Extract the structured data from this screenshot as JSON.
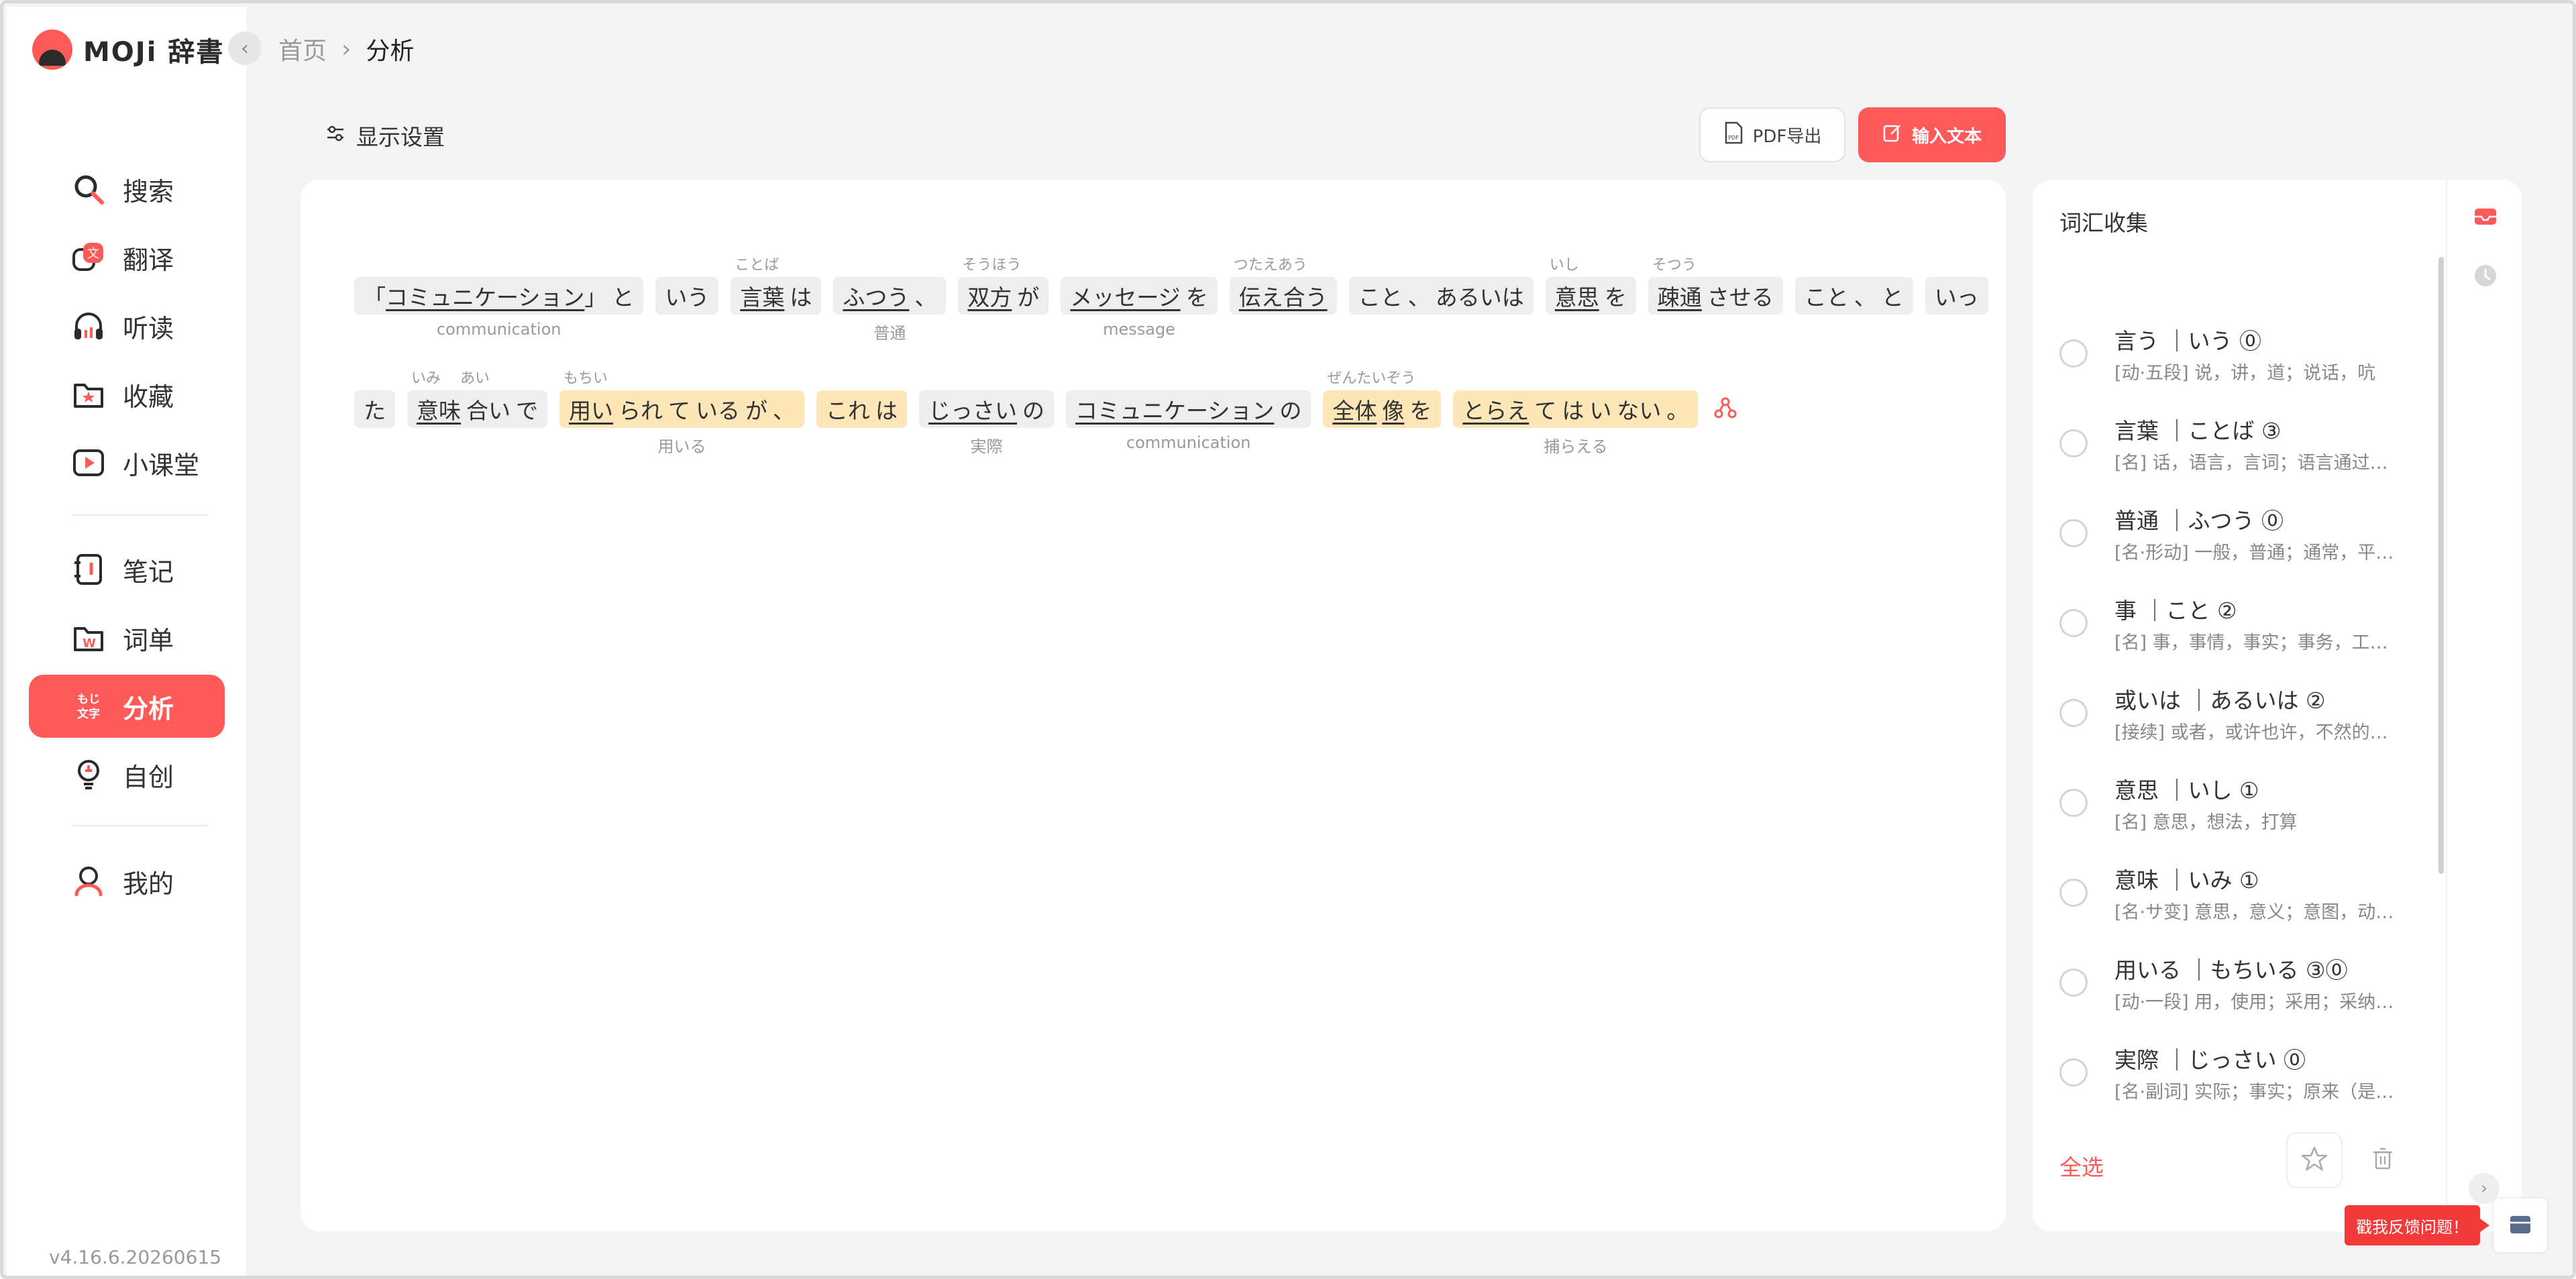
{
  "app": {
    "logo_text": "MOJi 辞書",
    "version": "v4.16.6.20260615"
  },
  "breadcrumb": {
    "home": "首页",
    "current": "分析"
  },
  "sidebar": {
    "items": [
      {
        "label": "搜索",
        "icon": "search-icon"
      },
      {
        "label": "翻译",
        "icon": "translate-icon"
      },
      {
        "label": "听读",
        "icon": "headphones-icon"
      },
      {
        "label": "收藏",
        "icon": "folder-star-icon"
      },
      {
        "label": "小课堂",
        "icon": "play-icon"
      },
      {
        "label": "笔记",
        "icon": "notebook-icon"
      },
      {
        "label": "词单",
        "icon": "wordlist-icon"
      },
      {
        "label": "分析",
        "icon": "moji-text-icon",
        "icon_text": "もじ文字"
      },
      {
        "label": "自创",
        "icon": "lightbulb-icon"
      },
      {
        "label": "我的",
        "icon": "user-icon"
      }
    ],
    "active": "分析"
  },
  "toolbar": {
    "display_settings": "显示设置",
    "pdf_export": "PDF导出",
    "input_text": "输入文本"
  },
  "analysis": {
    "line1": [
      {
        "parts": [
          {
            "t": "「"
          },
          {
            "t": "コミュニケーション",
            "u": true
          },
          {
            "t": "」"
          },
          {
            "t": "と",
            "sp": true
          }
        ],
        "gloss": "communication"
      },
      {
        "parts": [
          {
            "t": "いう"
          }
        ]
      },
      {
        "parts": [
          {
            "t": "言葉",
            "u": true
          },
          {
            "t": "は",
            "sp": true
          }
        ],
        "ruby": "ことば"
      },
      {
        "parts": [
          {
            "t": "ふつう",
            "u": true
          },
          {
            "t": "、",
            "sp": true
          }
        ],
        "gloss": "普通"
      },
      {
        "parts": [
          {
            "t": "双方",
            "u": true
          },
          {
            "t": "が",
            "sp": true
          }
        ],
        "ruby": "そうほう"
      },
      {
        "parts": [
          {
            "t": "メッセージ",
            "u": true
          },
          {
            "t": "を",
            "sp": true
          }
        ],
        "gloss": "message"
      },
      {
        "parts": [
          {
            "t": "伝え合う",
            "u": true
          }
        ],
        "ruby": "つたえあう"
      },
      {
        "parts": [
          {
            "t": "こと"
          },
          {
            "t": "、",
            "sp": true
          },
          {
            "t": "あるいは",
            "sp": true
          }
        ]
      },
      {
        "parts": [
          {
            "t": "意思",
            "u": true
          },
          {
            "t": "を",
            "sp": true
          }
        ],
        "ruby": "いし"
      },
      {
        "parts": [
          {
            "t": "疎通",
            "u": true
          },
          {
            "t": "させる",
            "sp": true
          }
        ],
        "ruby": "そつう"
      },
      {
        "parts": [
          {
            "t": "こと"
          },
          {
            "t": "、",
            "sp": true
          },
          {
            "t": "と",
            "sp": true
          }
        ]
      },
      {
        "parts": [
          {
            "t": "いっ"
          }
        ]
      }
    ],
    "line2": [
      {
        "parts": [
          {
            "t": "た"
          }
        ]
      },
      {
        "parts": [
          {
            "t": "意味",
            "u": true
          },
          {
            "t": "合い",
            "sp": true
          },
          {
            "t": "で",
            "sp": true
          }
        ],
        "ruby": "いみ　 あい"
      },
      {
        "parts": [
          {
            "t": "用い",
            "u": true
          },
          {
            "t": "られ",
            "sp": true
          },
          {
            "t": "て",
            "sp": true
          },
          {
            "t": "いる",
            "sp": true
          },
          {
            "t": "が",
            "sp": true
          },
          {
            "t": "、",
            "sp": true
          }
        ],
        "ruby": "もちい",
        "gloss": "用いる",
        "hl": true
      },
      {
        "parts": [
          {
            "t": "これ"
          },
          {
            "t": "は",
            "sp": true
          }
        ],
        "hl": true
      },
      {
        "parts": [
          {
            "t": "じっさい",
            "u": true
          },
          {
            "t": "の",
            "sp": true
          }
        ],
        "gloss": "実際"
      },
      {
        "parts": [
          {
            "t": "コミュニケーション",
            "u": true
          },
          {
            "t": "の",
            "sp": true
          }
        ],
        "gloss": "communication"
      },
      {
        "parts": [
          {
            "t": "全体",
            "u": true
          },
          {
            "t": "像",
            "u": true,
            "sp": true
          },
          {
            "t": "を",
            "sp": true
          }
        ],
        "ruby": "ぜんたいぞう",
        "hl": true
      },
      {
        "parts": [
          {
            "t": "とらえ",
            "u": true
          },
          {
            "t": "て",
            "sp": true
          },
          {
            "t": "は",
            "sp": true
          },
          {
            "t": "い",
            "sp": true
          },
          {
            "t": "ない",
            "sp": true
          },
          {
            "t": "。",
            "sp": true
          }
        ],
        "gloss": "捕らえる",
        "hl": true
      }
    ]
  },
  "vocab": {
    "title": "词汇收集",
    "items": [
      {
        "word": "言う ｜いう ⓪",
        "def": "[动·五段] 说，讲，道；说话，吭"
      },
      {
        "word": "言葉 ｜ことば ③",
        "def": "[名] 话，语言，言词；语言通过…"
      },
      {
        "word": "普通 ｜ふつう ⓪",
        "def": "[名·形动] 一般，普通；通常，平…"
      },
      {
        "word": "事 ｜こと ②",
        "def": "[名] 事，事情，事实；事务，工…"
      },
      {
        "word": "或いは ｜あるいは ②",
        "def": "[接续] 或者，或许也许，不然的…"
      },
      {
        "word": "意思 ｜いし ①",
        "def": "[名] 意思，想法，打算"
      },
      {
        "word": "意味 ｜いみ ①",
        "def": "[名·サ变] 意思，意义；意图，动…"
      },
      {
        "word": "用いる ｜もちいる ③⓪",
        "def": "[动·一段] 用，使用；采用；采纳…"
      },
      {
        "word": "実際 ｜じっさい ⓪",
        "def": "[名·副词] 实际；事实；原来（是…"
      }
    ],
    "select_all": "全选"
  },
  "feedback": {
    "label": "戳我反馈问题！"
  },
  "colors": {
    "accent": "#ff5a5a",
    "highlight": "#fde6b8",
    "token_bg": "#eeeeef"
  }
}
